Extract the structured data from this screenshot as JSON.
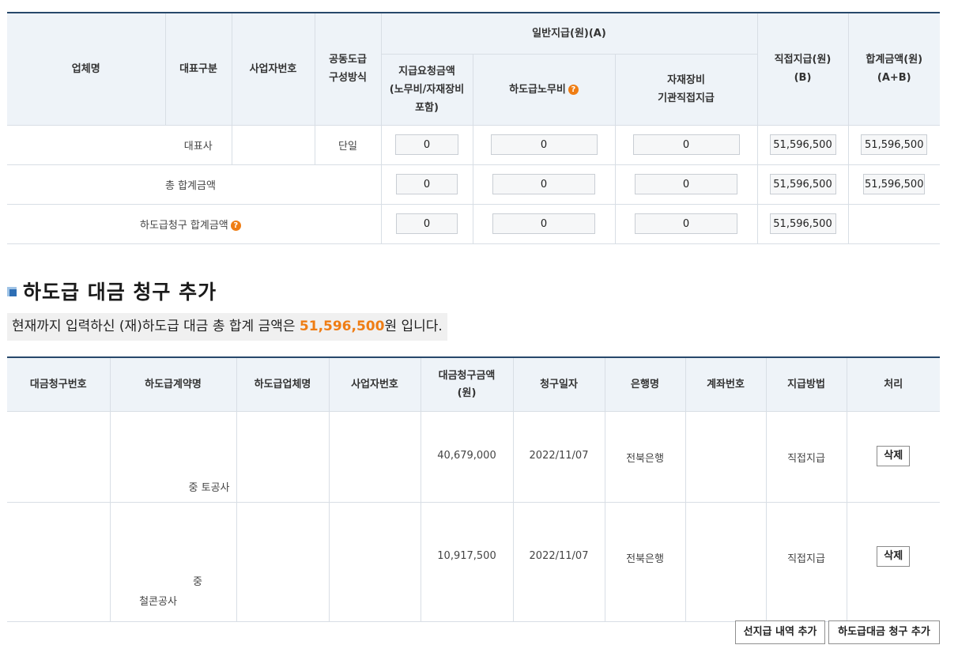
{
  "summary": {
    "headers": {
      "company": "업체명",
      "rep_type": "대표구분",
      "biz_no": "사업자번호",
      "joint_line1": "공동도급",
      "joint_line2": "구성방식",
      "general_group": "일반지급(원)(A)",
      "request_l1": "지급요청금액",
      "request_l2": "(노무비/자재장비",
      "request_l3": "포함)",
      "sub_labor": "하도급노무비",
      "equip_l1": "자재장비",
      "equip_l2": "기관직접지급",
      "direct_l1": "직접지급(원)",
      "direct_l2": "(B)",
      "total_l1": "합계금액(원)",
      "total_l2": "(A+B)"
    },
    "row_rep": {
      "rep_type": "대표사",
      "joint": "단일",
      "request": "0",
      "sub_labor": "0",
      "equip": "0",
      "direct": "51,596,500",
      "total": "51,596,500"
    },
    "row_total": {
      "label": "총 합계금액",
      "request": "0",
      "sub_labor": "0",
      "equip": "0",
      "direct": "51,596,500",
      "total": "51,596,500"
    },
    "row_claim": {
      "label": "하도급청구 합계금액",
      "request": "0",
      "sub_labor": "0",
      "equip": "0",
      "direct": "51,596,500"
    },
    "help_glyph": "?"
  },
  "section": {
    "title": "하도급 대금 청구 추가",
    "banner_prefix": "현재까지 입력하신 (재)하도급 대금 총 합계 금액은 ",
    "banner_amount": "51,596,500",
    "banner_suffix": "원 입니다."
  },
  "claims": {
    "headers": {
      "claim_no": "대금청구번호",
      "contract": "하도급계약명",
      "company": "하도급업체명",
      "biz_no": "사업자번호",
      "amount_l1": "대금청구금액",
      "amount_l2": "(원)",
      "date": "청구일자",
      "bank": "은행명",
      "account": "계좌번호",
      "method": "지급방법",
      "action": "처리"
    },
    "rows": [
      {
        "contract": "중 토공사",
        "amount": "40,679,000",
        "date": "2022/11/07",
        "bank": "전북은행",
        "method": "직접지급",
        "action": "삭제"
      },
      {
        "contract_l1": "중",
        "contract_l2": "철콘공사",
        "amount": "10,917,500",
        "date": "2022/11/07",
        "bank": "전북은행",
        "method": "직접지급",
        "action": "삭제"
      }
    ]
  },
  "buttons": {
    "prepay": "선지급 내역 추가",
    "add_claim": "하도급대금 청구 추가"
  },
  "colors": {
    "header_bg": "#eef3f8",
    "header_border": "#27486b",
    "accent": "#ef7d14"
  }
}
